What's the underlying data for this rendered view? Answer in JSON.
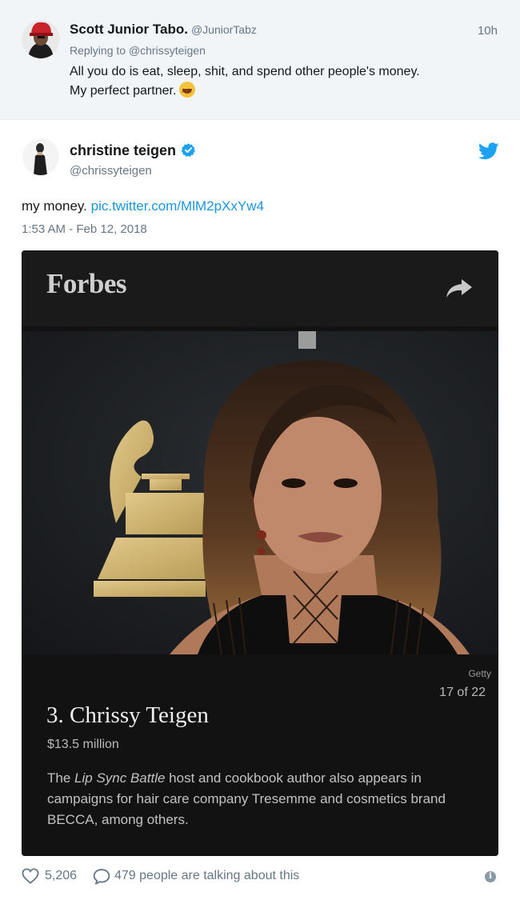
{
  "reply_tweet": {
    "author_name": "Scott Junior Tabo.",
    "author_handle": "@JuniorTabz",
    "time": "10h",
    "replying_to_prefix": "Replying to",
    "replying_to_handle": "@chrissyteigen",
    "text_line1": "All you do is eat, sleep, shit,  and spend other people's money.",
    "text_line2": "My perfect partner.",
    "emoji": "grinning-squinting-face"
  },
  "main_tweet": {
    "author_name": "christine teigen",
    "author_handle": "@chrissyteigen",
    "verified": true,
    "text": "my money.",
    "link": "pic.twitter.com/MlM2pXxYw4",
    "timestamp": "1:53 AM - Feb 12, 2018",
    "brand_icon": "twitter-bird-icon",
    "brand_color": "#1da1f2"
  },
  "card": {
    "logo": "Forbes",
    "photo_credit": "Getty",
    "counter": "17 of 22",
    "title": "3. Chrissy Teigen",
    "net_worth": "$13.5 million",
    "desc_prefix": "The",
    "desc_italic": "Lip Sync Battle",
    "desc_rest": "host and cookbook author also appears in campaigns for hair care company Tresemme and cosmetics brand BECCA, among others."
  },
  "footer": {
    "likes": "5,206",
    "talking": "479 people are talking about this"
  }
}
